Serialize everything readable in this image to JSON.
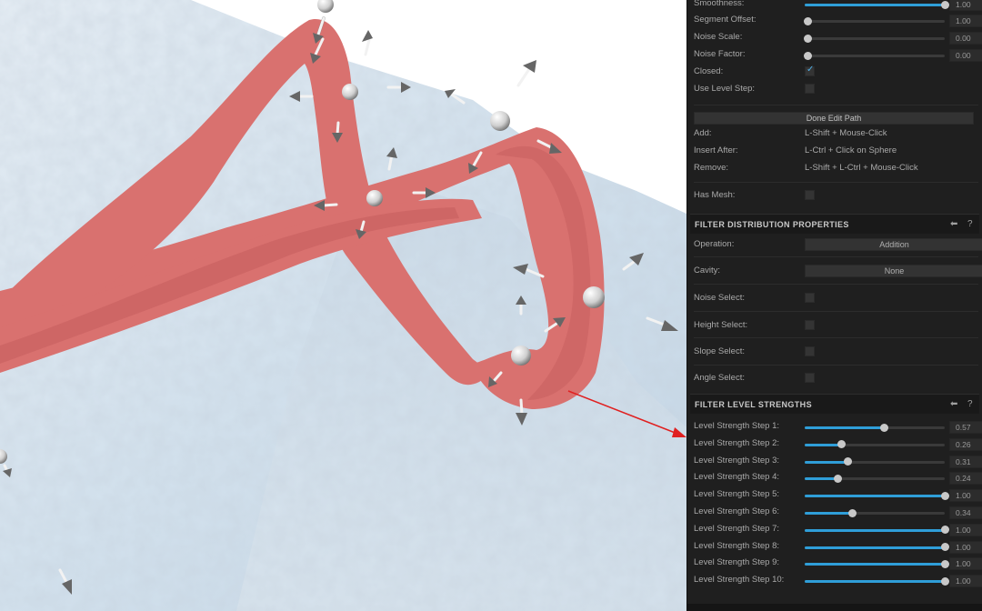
{
  "path_settings": {
    "smoothness": {
      "label": "Smoothness:",
      "value": 1.0,
      "display": "1.00"
    },
    "segment_offset": {
      "label": "Segment Offset:",
      "value": 0.0,
      "display": "1.00"
    },
    "noise_scale": {
      "label": "Noise Scale:",
      "value": 0.0,
      "display": "0.00"
    },
    "noise_factor": {
      "label": "Noise Factor:",
      "value": 0.0,
      "display": "0.00"
    },
    "closed": {
      "label": "Closed:",
      "checked": true
    },
    "use_level_step": {
      "label": "Use Level Step:",
      "checked": false
    },
    "done_edit_button": "Done Edit Path",
    "hints": [
      {
        "label": "Add:",
        "value": "L-Shift + Mouse-Click"
      },
      {
        "label": "Insert After:",
        "value": "L-Ctrl + Click on Sphere"
      },
      {
        "label": "Remove:",
        "value": "L-Shift + L-Ctrl + Mouse-Click"
      }
    ],
    "has_mesh": {
      "label": "Has Mesh:",
      "checked": false
    }
  },
  "filter_distribution": {
    "title": "FILTER DISTRIBUTION PROPERTIES",
    "operation": {
      "label": "Operation:",
      "value": "Addition"
    },
    "cavity": {
      "label": "Cavity:",
      "value": "None"
    },
    "noise_select": {
      "label": "Noise Select:",
      "checked": false
    },
    "height_select": {
      "label": "Height Select:",
      "checked": false
    },
    "slope_select": {
      "label": "Slope Select:",
      "checked": false
    },
    "angle_select": {
      "label": "Angle Select:",
      "checked": false
    }
  },
  "filter_level_strengths": {
    "title": "FILTER LEVEL STRENGTHS",
    "steps": [
      {
        "label": "Level Strength Step 1:",
        "value": 0.57,
        "display": "0.57"
      },
      {
        "label": "Level Strength Step 2:",
        "value": 0.26,
        "display": "0.26"
      },
      {
        "label": "Level Strength Step 3:",
        "value": 0.31,
        "display": "0.31"
      },
      {
        "label": "Level Strength Step 4:",
        "value": 0.24,
        "display": "0.24"
      },
      {
        "label": "Level Strength Step 5:",
        "value": 1.0,
        "display": "1.00"
      },
      {
        "label": "Level Strength Step 6:",
        "value": 0.34,
        "display": "0.34"
      },
      {
        "label": "Level Strength Step 7:",
        "value": 1.0,
        "display": "1.00"
      },
      {
        "label": "Level Strength Step 8:",
        "value": 1.0,
        "display": "1.00"
      },
      {
        "label": "Level Strength Step 9:",
        "value": 1.0,
        "display": "1.00"
      },
      {
        "label": "Level Strength Step 10:",
        "value": 1.0,
        "display": "1.00"
      }
    ]
  },
  "icons": {
    "back": "back-arrow-icon",
    "help": "help-icon"
  },
  "colors": {
    "accent": "#2f9ed8",
    "path": "#d9716f",
    "annotation_arrow": "#e02020"
  }
}
